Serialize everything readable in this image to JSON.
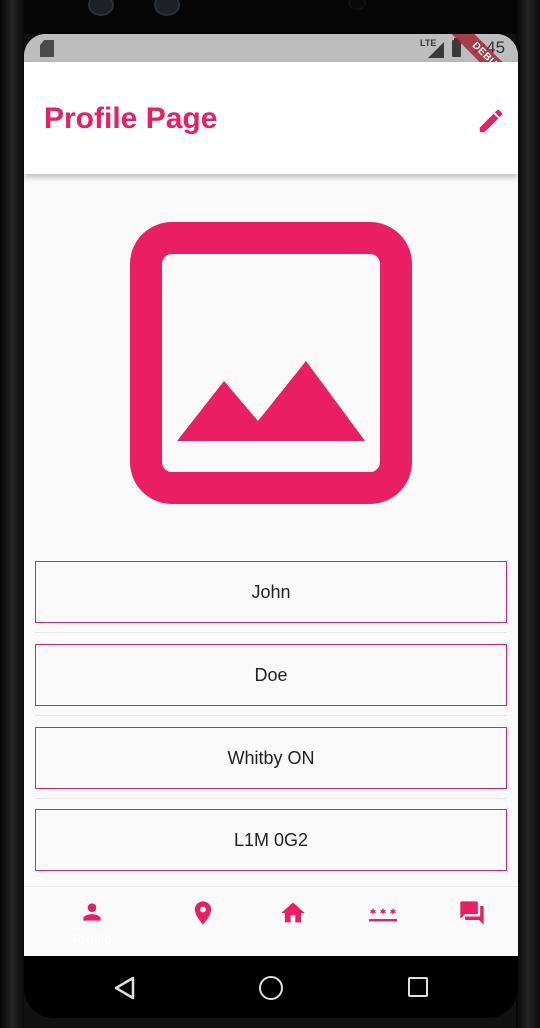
{
  "status_bar": {
    "network": "LTE",
    "time": "7:45",
    "debug_banner": "DEBUG"
  },
  "app_bar": {
    "title": "Profile Page",
    "action_icon": "edit-icon"
  },
  "profile_image": {
    "icon": "image-placeholder-icon"
  },
  "fields": [
    {
      "value": "John"
    },
    {
      "value": "Doe"
    },
    {
      "value": "Whitby ON"
    },
    {
      "value": "L1M 0G2"
    }
  ],
  "bottom_nav": {
    "items": [
      {
        "icon": "person-icon",
        "label": "Profile",
        "selected": true
      },
      {
        "icon": "location-pin-icon",
        "label": ""
      },
      {
        "icon": "home-icon",
        "label": ""
      },
      {
        "icon": "password-icon",
        "label": ""
      },
      {
        "icon": "chat-icon",
        "label": ""
      }
    ]
  },
  "system_nav": {
    "back": "back-icon",
    "home": "home-circle-icon",
    "recents": "recents-icon"
  },
  "colors": {
    "accent": "#e91e63",
    "background": "#fafafa",
    "app_bar": "#ffffff",
    "status_bar": "#bdbdbd"
  }
}
